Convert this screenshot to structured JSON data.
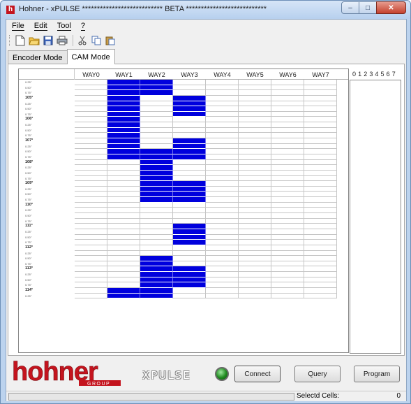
{
  "window": {
    "title": "Hohner - xPULSE *************************** BETA ***************************",
    "app_icon": "h",
    "minimize_glyph": "–",
    "maximize_glyph": "□",
    "close_glyph": "✕"
  },
  "menu": {
    "file": "File",
    "edit": "Edit",
    "tool": "Tool",
    "help": "?"
  },
  "toolbar": {
    "buttons": [
      {
        "icon": "new-file-icon",
        "glyph": "🗋"
      },
      {
        "icon": "open-folder-icon",
        "glyph": "📂"
      },
      {
        "icon": "save-icon",
        "glyph": "💾"
      },
      {
        "icon": "print-icon",
        "glyph": "🖶"
      },
      {
        "icon": "cut-icon",
        "glyph": "✂"
      },
      {
        "icon": "copy-icon",
        "glyph": "⧉"
      },
      {
        "icon": "paste-icon",
        "glyph": "📋"
      }
    ]
  },
  "tabs": [
    {
      "label": "Encoder Mode",
      "active": false
    },
    {
      "label": "CAM Mode",
      "active": true
    }
  ],
  "grid": {
    "columns": [
      "WAY0",
      "WAY1",
      "WAY2",
      "WAY3",
      "WAY4",
      "WAY5",
      "WAY6",
      "WAY7"
    ],
    "rows": [
      {
        "label": "0.25°",
        "on": [
          1,
          2
        ]
      },
      {
        "label": "0.50°",
        "on": [
          1,
          2
        ]
      },
      {
        "label": "0.75°",
        "on": [
          1,
          2
        ]
      },
      {
        "label": "105°",
        "major": true,
        "on": [
          1,
          3
        ]
      },
      {
        "label": "0.25°",
        "on": [
          1,
          3
        ]
      },
      {
        "label": "0.50°",
        "on": [
          1,
          3
        ]
      },
      {
        "label": "0.75°",
        "on": [
          1,
          3
        ]
      },
      {
        "label": "106°",
        "major": true,
        "on": [
          1
        ]
      },
      {
        "label": "0.25°",
        "on": [
          1
        ]
      },
      {
        "label": "0.50°",
        "on": [
          1
        ]
      },
      {
        "label": "0.75°",
        "on": [
          1
        ]
      },
      {
        "label": "107°",
        "major": true,
        "on": [
          1,
          3
        ]
      },
      {
        "label": "0.25°",
        "on": [
          1,
          3
        ]
      },
      {
        "label": "0.50°",
        "on": [
          1,
          2,
          3
        ]
      },
      {
        "label": "0.75°",
        "on": [
          1,
          2,
          3
        ]
      },
      {
        "label": "108°",
        "major": true,
        "on": [
          2
        ]
      },
      {
        "label": "0.25°",
        "on": [
          2
        ]
      },
      {
        "label": "0.50°",
        "on": [
          2
        ]
      },
      {
        "label": "0.75°",
        "on": [
          2
        ]
      },
      {
        "label": "109°",
        "major": true,
        "on": [
          2,
          3
        ]
      },
      {
        "label": "0.25°",
        "on": [
          2,
          3
        ]
      },
      {
        "label": "0.50°",
        "on": [
          2,
          3
        ]
      },
      {
        "label": "0.75°",
        "on": [
          2,
          3
        ]
      },
      {
        "label": "110°",
        "major": true,
        "on": []
      },
      {
        "label": "0.25°",
        "on": []
      },
      {
        "label": "0.50°",
        "on": []
      },
      {
        "label": "0.75°",
        "on": []
      },
      {
        "label": "111°",
        "major": true,
        "on": [
          3
        ]
      },
      {
        "label": "0.25°",
        "on": [
          3
        ]
      },
      {
        "label": "0.50°",
        "on": [
          3
        ]
      },
      {
        "label": "0.75°",
        "on": [
          3
        ]
      },
      {
        "label": "112°",
        "major": true,
        "on": []
      },
      {
        "label": "0.25°",
        "on": []
      },
      {
        "label": "0.50°",
        "on": [
          2
        ]
      },
      {
        "label": "0.75°",
        "on": [
          2
        ]
      },
      {
        "label": "113°",
        "major": true,
        "on": [
          2,
          3
        ]
      },
      {
        "label": "0.25°",
        "on": [
          2,
          3
        ]
      },
      {
        "label": "0.50°",
        "on": [
          2,
          3
        ]
      },
      {
        "label": "0.75°",
        "on": [
          2,
          3
        ]
      },
      {
        "label": "114°",
        "major": true,
        "on": [
          1,
          2
        ]
      },
      {
        "label": "0.25°",
        "on": [
          1,
          2
        ]
      }
    ],
    "on_color": "#0000dd"
  },
  "bits": {
    "header": "0 1 2 3 4 5 6 7"
  },
  "bottom": {
    "logo_text": "hohner",
    "logo_group": "GROUP",
    "product_name": "XPULSE",
    "led_color": "#1f8a1f",
    "connect_label": "Connect",
    "query_label": "Query",
    "program_label": "Program",
    "brand_color": "#c4141e"
  },
  "status": {
    "label": "Selectd Cells:",
    "value": "0",
    "progress": 0
  }
}
